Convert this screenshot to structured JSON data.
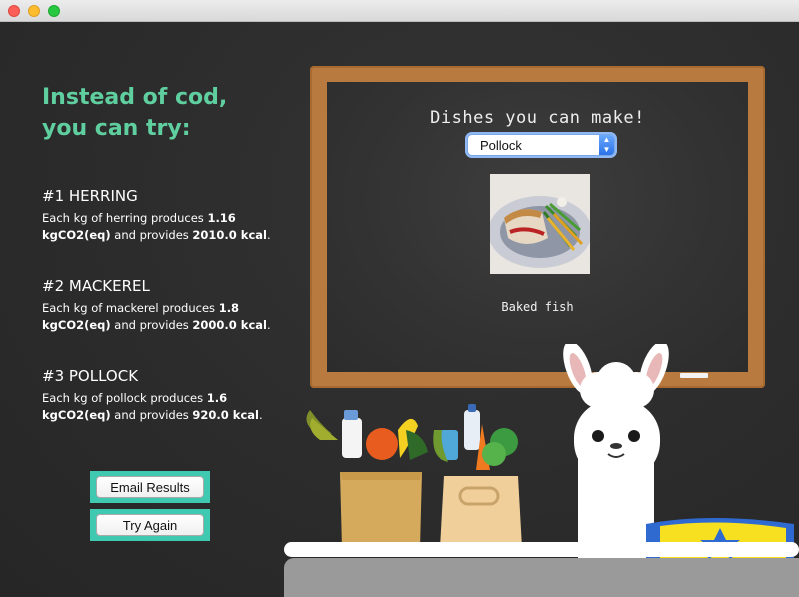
{
  "window": {
    "title": ""
  },
  "heading": {
    "line1": "Instead of cod,",
    "line2": "you can try:"
  },
  "alternatives": [
    {
      "title": "#1 HERRING",
      "desc_pre": "Each kg of herring produces ",
      "co2": "1.16",
      "unit": "kgCO2(eq)",
      "mid": " and provides ",
      "kcal": "2010.0 kcal",
      "post": "."
    },
    {
      "title": "#2 MACKEREL",
      "desc_pre": "Each kg of mackerel produces ",
      "co2": "1.8",
      "unit": "kgCO2(eq)",
      "mid": " and provides ",
      "kcal": "2000.0 kcal",
      "post": "."
    },
    {
      "title": "#3 POLLOCK",
      "desc_pre": "Each kg of pollock produces ",
      "co2": "1.6",
      "unit": "kgCO2(eq)",
      "mid": " and provides ",
      "kcal": "920.0 kcal",
      "post": "."
    }
  ],
  "buttons": {
    "email": "Email Results",
    "retry": "Try Again"
  },
  "board": {
    "title": "Dishes you can make!",
    "select_value": "Pollock",
    "dish_name": "Baked fish"
  },
  "colors": {
    "accent": "#5fcfa0",
    "button_border": "#3fc9b0",
    "board_frame": "#b87a3e",
    "background": "#2e2e2e"
  }
}
